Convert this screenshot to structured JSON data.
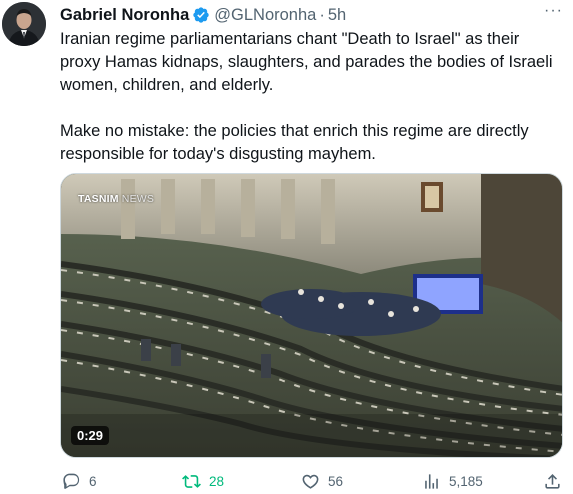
{
  "author": {
    "name": "Gabriel Noronha",
    "handle": "@GLNoronha",
    "time": "5h"
  },
  "more_label": "···",
  "tweet": {
    "paragraphs": [
      "Iranian regime parliamentarians chant \"Death to Israel\" as their proxy Hamas kidnaps, slaughters, and parades the bodies of Israeli women, children, and elderly.",
      "Make no mistake: the policies that enrich this regime are directly responsible for today's disgusting mayhem."
    ]
  },
  "media": {
    "brand_primary": "TASNIM",
    "brand_secondary": "NEWS",
    "duration": "0:29"
  },
  "actions": {
    "replies": "6",
    "retweets": "28",
    "likes": "56",
    "views": "5,185"
  },
  "colors": {
    "verified": "#1d9bf0",
    "retweet_active": "#00ba7c",
    "muted": "#536471"
  },
  "icons": [
    "verified-badge-icon",
    "more-icon",
    "reply-icon",
    "retweet-icon",
    "like-icon",
    "views-icon",
    "share-icon",
    "play-icon"
  ]
}
